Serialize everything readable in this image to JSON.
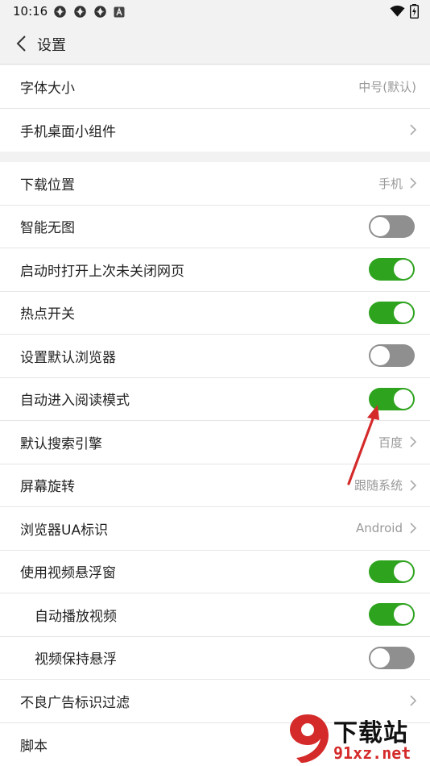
{
  "status_bar": {
    "time": "10:16",
    "left_icons": [
      "sync-icon",
      "sync-icon",
      "sync-icon",
      "notification-a-icon"
    ],
    "right_icons": [
      "wifi-icon",
      "battery-charging-icon"
    ]
  },
  "header": {
    "back_icon": "chevron-left-icon",
    "title": "设置"
  },
  "groups": [
    {
      "rows": [
        {
          "label": "字体大小",
          "type": "value",
          "value": "中号(默认)",
          "chevron": false
        },
        {
          "label": "手机桌面小组件",
          "type": "chevron"
        }
      ]
    },
    {
      "rows": [
        {
          "label": "下载位置",
          "type": "value",
          "value": "手机",
          "chevron": true
        },
        {
          "label": "智能无图",
          "type": "toggle",
          "on": false
        },
        {
          "label": "启动时打开上次未关闭网页",
          "type": "toggle",
          "on": true
        },
        {
          "label": "热点开关",
          "type": "toggle",
          "on": true
        },
        {
          "label": "设置默认浏览器",
          "type": "toggle",
          "on": false
        },
        {
          "label": "自动进入阅读模式",
          "type": "toggle",
          "on": true
        },
        {
          "label": "默认搜索引擎",
          "type": "value",
          "value": "百度",
          "chevron": true
        },
        {
          "label": "屏幕旋转",
          "type": "value",
          "value": "跟随系统",
          "chevron": true
        },
        {
          "label": "浏览器UA标识",
          "type": "value",
          "value": "Android",
          "chevron": true
        },
        {
          "label": "使用视频悬浮窗",
          "type": "toggle",
          "on": true
        },
        {
          "label": "自动播放视频",
          "type": "toggle",
          "on": true,
          "sub": true
        },
        {
          "label": "视频保持悬浮",
          "type": "toggle",
          "on": false,
          "sub": true
        },
        {
          "label": "不良广告标识过滤",
          "type": "chevron"
        },
        {
          "label": "脚本",
          "type": "plain"
        }
      ]
    }
  ],
  "colors": {
    "toggle_on": "#2ea31e",
    "toggle_off": "#8f8f8f",
    "annotation_arrow": "#d42a2a"
  },
  "watermark": {
    "logo_icon": "site-logo-icon",
    "title": "下载站",
    "url": "91xz.net"
  }
}
